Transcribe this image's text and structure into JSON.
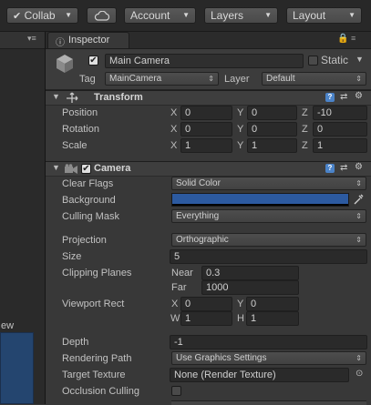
{
  "toolbar": {
    "collab": "Collab",
    "account": "Account",
    "layers": "Layers",
    "layout": "Layout"
  },
  "scene_partial_label": "ew",
  "inspector": {
    "tab_label": "Inspector",
    "object": {
      "name": "Main Camera",
      "active": true,
      "static_label": "Static",
      "static": false,
      "tag_label": "Tag",
      "tag_value": "MainCamera",
      "layer_label": "Layer",
      "layer_value": "Default"
    },
    "transform": {
      "title": "Transform",
      "position_label": "Position",
      "rotation_label": "Rotation",
      "scale_label": "Scale",
      "position": {
        "x": "0",
        "y": "0",
        "z": "-10"
      },
      "rotation": {
        "x": "0",
        "y": "0",
        "z": "0"
      },
      "scale": {
        "x": "1",
        "y": "1",
        "z": "1"
      },
      "axis_x": "X",
      "axis_y": "Y",
      "axis_z": "Z"
    },
    "camera": {
      "title": "Camera",
      "enabled": true,
      "clear_flags_label": "Clear Flags",
      "clear_flags_value": "Solid Color",
      "background_label": "Background",
      "background_color": "#2c5aa0",
      "culling_mask_label": "Culling Mask",
      "culling_mask_value": "Everything",
      "projection_label": "Projection",
      "projection_value": "Orthographic",
      "size_label": "Size",
      "size_value": "5",
      "clipping_label": "Clipping Planes",
      "near_label": "Near",
      "near_value": "0.3",
      "far_label": "Far",
      "far_value": "1000",
      "viewport_label": "Viewport Rect",
      "vp_x_label": "X",
      "vp_x": "0",
      "vp_y_label": "Y",
      "vp_y": "0",
      "vp_w_label": "W",
      "vp_w": "1",
      "vp_h_label": "H",
      "vp_h": "1",
      "depth_label": "Depth",
      "depth_value": "-1",
      "rendering_path_label": "Rendering Path",
      "rendering_path_value": "Use Graphics Settings",
      "target_texture_label": "Target Texture",
      "target_texture_value": "None (Render Texture)",
      "occlusion_label": "Occlusion Culling",
      "occlusion": false
    }
  }
}
